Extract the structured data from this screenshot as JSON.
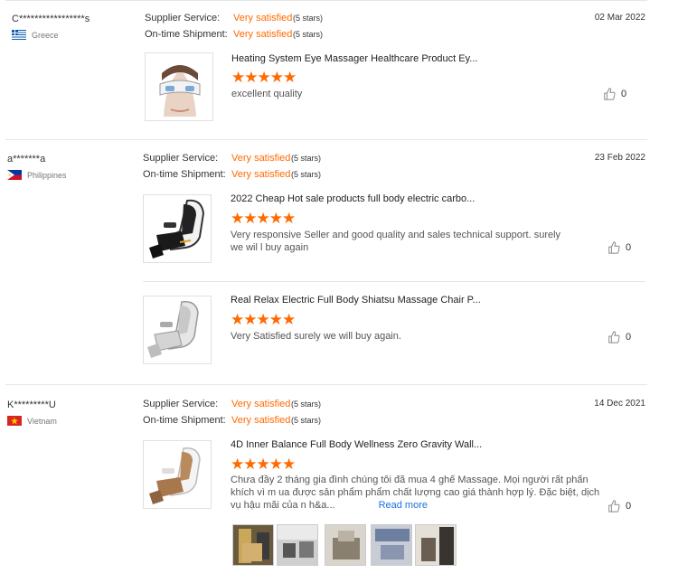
{
  "reviews": [
    {
      "user": "C*****************s",
      "country": "Greece",
      "supplier_label": "Supplier Service:",
      "supplier_value": "Very satisfied",
      "supplier_stars": "(5 stars)",
      "shipment_label": "On-time Shipment:",
      "shipment_value": "Very satisfied",
      "shipment_stars": "(5 stars)",
      "date": "02 Mar 2022",
      "products": [
        {
          "title": "Heating System Eye Massager Healthcare Product Ey...",
          "stars": "★★★★★",
          "comment": "excellent quality",
          "likes": "0"
        }
      ]
    },
    {
      "user": "a*******a",
      "country": "Philippines",
      "supplier_label": "Supplier Service:",
      "supplier_value": "Very satisfied",
      "supplier_stars": "(5 stars)",
      "shipment_label": "On-time Shipment:",
      "shipment_value": "Very satisfied",
      "shipment_stars": "(5 stars)",
      "date": "23 Feb 2022",
      "products": [
        {
          "title": "2022 Cheap Hot sale products full body electric carbo...",
          "stars": "★★★★★",
          "comment": "Very responsive Seller and good quality and sales technical support. surely we wil l buy again",
          "likes": "0"
        },
        {
          "title": "Real Relax Electric Full Body Shiatsu Massage Chair P...",
          "stars": "★★★★★",
          "comment": "Very Satisfied surely we will buy again.",
          "likes": "0"
        }
      ]
    },
    {
      "user": "K*********U",
      "country": "Vietnam",
      "supplier_label": "Supplier Service:",
      "supplier_value": "Very satisfied",
      "supplier_stars": "(5 stars)",
      "shipment_label": "On-time Shipment:",
      "shipment_value": "Very satisfied",
      "shipment_stars": "(5 stars)",
      "date": "14 Dec 2021",
      "products": [
        {
          "title": "4D Inner Balance Full Body Wellness Zero Gravity Wall...",
          "stars": "★★★★★",
          "comment": "Chưa đầy 2 tháng gia đình chúng tôi đã mua 4 ghế Massage. Mọi người rất phấn khích vì m ua được sản phẩm phẩm chất lượng cao giá thành hợp lý. Đặc biệt, dịch vụ hậu mãi của n h&a...",
          "read_more": "Read more",
          "likes": "0"
        }
      ]
    }
  ],
  "colors": {
    "accent": "#ff6a00",
    "link": "#1a73d9"
  }
}
